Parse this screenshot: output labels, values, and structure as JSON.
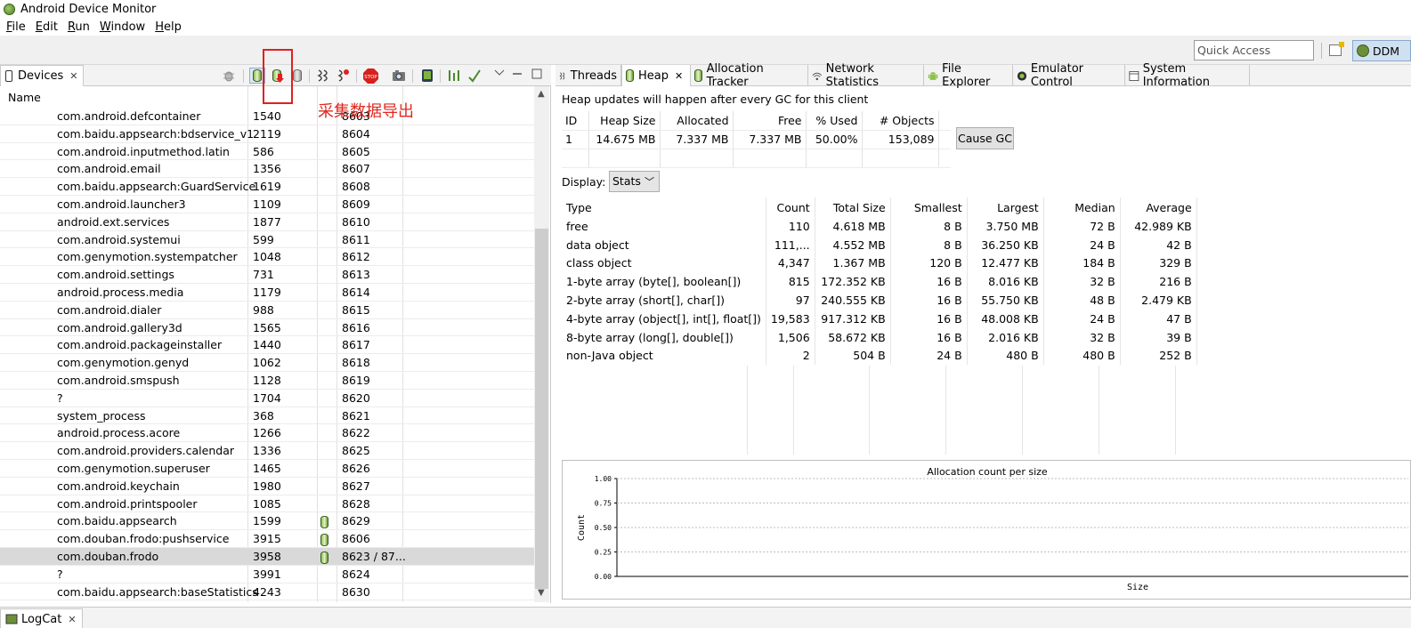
{
  "window": {
    "title": "Android Device Monitor"
  },
  "menu": [
    "File",
    "Edit",
    "Run",
    "Window",
    "Help"
  ],
  "toolbar": {
    "quick_access_placeholder": "Quick Access",
    "perspective_label": "DDM"
  },
  "devices": {
    "tab_label": "Devices",
    "column_name": "Name",
    "annotation": "采集数据导出",
    "rows": [
      {
        "name": "com.android.defcontainer",
        "pid": "1540",
        "port": "8603",
        "heap": false
      },
      {
        "name": "com.baidu.appsearch:bdservice_v1",
        "pid": "2119",
        "port": "8604",
        "heap": false
      },
      {
        "name": "com.android.inputmethod.latin",
        "pid": "586",
        "port": "8605",
        "heap": false
      },
      {
        "name": "com.android.email",
        "pid": "1356",
        "port": "8607",
        "heap": false
      },
      {
        "name": "com.baidu.appsearch:GuardService",
        "pid": "1619",
        "port": "8608",
        "heap": false
      },
      {
        "name": "com.android.launcher3",
        "pid": "1109",
        "port": "8609",
        "heap": false
      },
      {
        "name": "android.ext.services",
        "pid": "1877",
        "port": "8610",
        "heap": false
      },
      {
        "name": "com.android.systemui",
        "pid": "599",
        "port": "8611",
        "heap": false
      },
      {
        "name": "com.genymotion.systempatcher",
        "pid": "1048",
        "port": "8612",
        "heap": false
      },
      {
        "name": "com.android.settings",
        "pid": "731",
        "port": "8613",
        "heap": false
      },
      {
        "name": "android.process.media",
        "pid": "1179",
        "port": "8614",
        "heap": false
      },
      {
        "name": "com.android.dialer",
        "pid": "988",
        "port": "8615",
        "heap": false
      },
      {
        "name": "com.android.gallery3d",
        "pid": "1565",
        "port": "8616",
        "heap": false
      },
      {
        "name": "com.android.packageinstaller",
        "pid": "1440",
        "port": "8617",
        "heap": false
      },
      {
        "name": "com.genymotion.genyd",
        "pid": "1062",
        "port": "8618",
        "heap": false
      },
      {
        "name": "com.android.smspush",
        "pid": "1128",
        "port": "8619",
        "heap": false
      },
      {
        "name": "?",
        "pid": "1704",
        "port": "8620",
        "heap": false
      },
      {
        "name": "system_process",
        "pid": "368",
        "port": "8621",
        "heap": false
      },
      {
        "name": "android.process.acore",
        "pid": "1266",
        "port": "8622",
        "heap": false
      },
      {
        "name": "com.android.providers.calendar",
        "pid": "1336",
        "port": "8625",
        "heap": false
      },
      {
        "name": "com.genymotion.superuser",
        "pid": "1465",
        "port": "8626",
        "heap": false
      },
      {
        "name": "com.android.keychain",
        "pid": "1980",
        "port": "8627",
        "heap": false
      },
      {
        "name": "com.android.printspooler",
        "pid": "1085",
        "port": "8628",
        "heap": false
      },
      {
        "name": "com.baidu.appsearch",
        "pid": "1599",
        "port": "8629",
        "heap": true
      },
      {
        "name": "com.douban.frodo:pushservice",
        "pid": "3915",
        "port": "8606",
        "heap": true
      },
      {
        "name": "com.douban.frodo",
        "pid": "3958",
        "port": "8623 / 87...",
        "heap": true,
        "selected": true
      },
      {
        "name": "?",
        "pid": "3991",
        "port": "8624",
        "heap": false
      },
      {
        "name": "com.baidu.appsearch:baseStatistics",
        "pid": "4243",
        "port": "8630",
        "heap": false
      }
    ]
  },
  "tabs": [
    "Threads",
    "Heap",
    "Allocation Tracker",
    "Network Statistics",
    "File Explorer",
    "Emulator Control",
    "System Information"
  ],
  "heap": {
    "note": "Heap updates will happen after every GC for this client",
    "summary_headers": [
      "ID",
      "Heap Size",
      "Allocated",
      "Free",
      "% Used",
      "# Objects"
    ],
    "summary_row": [
      "1",
      "14.675 MB",
      "7.337 MB",
      "7.337 MB",
      "50.00%",
      "153,089"
    ],
    "cause_gc_label": "Cause GC",
    "display_label": "Display:",
    "display_value": "Stats",
    "stats_headers": [
      "Type",
      "Count",
      "Total Size",
      "Smallest",
      "Largest",
      "Median",
      "Average"
    ],
    "stats_rows": [
      [
        "free",
        "110",
        "4.618 MB",
        "8 B",
        "3.750 MB",
        "72 B",
        "42.989 KB"
      ],
      [
        "data object",
        "111,...",
        "4.552 MB",
        "8 B",
        "36.250 KB",
        "24 B",
        "42 B"
      ],
      [
        "class object",
        "4,347",
        "1.367 MB",
        "120 B",
        "12.477 KB",
        "184 B",
        "329 B"
      ],
      [
        "1-byte array (byte[], boolean[])",
        "815",
        "172.352 KB",
        "16 B",
        "8.016 KB",
        "32 B",
        "216 B"
      ],
      [
        "2-byte array (short[], char[])",
        "97",
        "240.555 KB",
        "16 B",
        "55.750 KB",
        "48 B",
        "2.479 KB"
      ],
      [
        "4-byte array (object[], int[], float[])",
        "19,583",
        "917.312 KB",
        "16 B",
        "48.008 KB",
        "24 B",
        "47 B"
      ],
      [
        "8-byte array (long[], double[])",
        "1,506",
        "58.672 KB",
        "16 B",
        "2.016 KB",
        "32 B",
        "39 B"
      ],
      [
        "non-Java object",
        "2",
        "504 B",
        "24 B",
        "480 B",
        "480 B",
        "252 B"
      ]
    ]
  },
  "chart_data": {
    "type": "bar",
    "title": "Allocation count per size",
    "xlabel": "Size",
    "ylabel": "Count",
    "ylim": [
      0,
      1
    ],
    "y_ticks": [
      "1.00",
      "0.75",
      "0.50",
      "0.25",
      "0.00"
    ],
    "categories": [],
    "values": []
  },
  "logcat": {
    "tab_label": "LogCat"
  }
}
